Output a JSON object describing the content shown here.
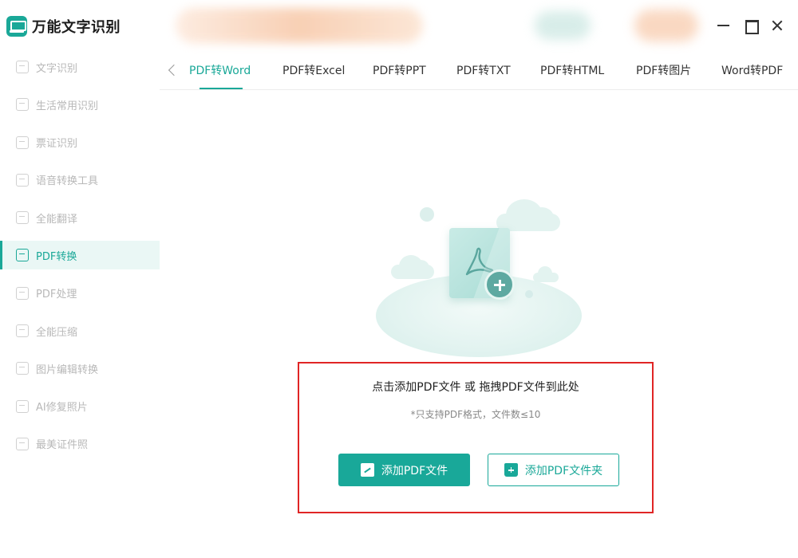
{
  "app": {
    "name": "万能文字识别",
    "accent_color": "#1aa898",
    "logo_icon": "scanner-icon"
  },
  "sidebar": {
    "items": [
      {
        "label": "文字识别",
        "icon": "text-scan-icon",
        "active": false
      },
      {
        "label": "生活常用识别",
        "icon": "life-scan-icon",
        "active": false
      },
      {
        "label": "票证识别",
        "icon": "ticket-scan-icon",
        "active": false
      },
      {
        "label": "语音转换工具",
        "icon": "voice-convert-icon",
        "active": false
      },
      {
        "label": "全能翻译",
        "icon": "translate-icon",
        "active": false
      },
      {
        "label": "PDF转换",
        "icon": "pdf-convert-icon",
        "active": true
      },
      {
        "label": "PDF处理",
        "icon": "pdf-process-icon",
        "active": false
      },
      {
        "label": "全能压缩",
        "icon": "compress-icon",
        "active": false
      },
      {
        "label": "图片编辑转换",
        "icon": "image-edit-icon",
        "active": false
      },
      {
        "label": "AI修复照片",
        "icon": "ai-photo-repair-icon",
        "active": false
      },
      {
        "label": "最美证件照",
        "icon": "id-photo-icon",
        "active": false
      }
    ]
  },
  "tabs": {
    "items": [
      {
        "label": "PDF转Word",
        "active": true
      },
      {
        "label": "PDF转Excel",
        "active": false
      },
      {
        "label": "PDF转PPT",
        "active": false
      },
      {
        "label": "PDF转TXT",
        "active": false
      },
      {
        "label": "PDF转HTML",
        "active": false
      },
      {
        "label": "PDF转图片",
        "active": false
      },
      {
        "label": "Word转PDF",
        "active": false
      }
    ]
  },
  "dropzone": {
    "title": "点击添加PDF文件 或 拖拽PDF文件到此处",
    "hint": "*只支持PDF格式，文件数≤10",
    "border_color": "#e02525",
    "add_file_label": "添加PDF文件",
    "add_folder_label": "添加PDF文件夹"
  }
}
